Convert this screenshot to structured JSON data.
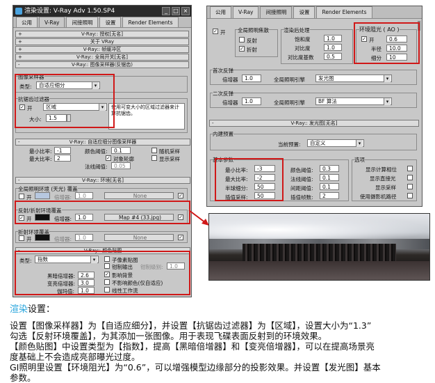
{
  "left": {
    "title": "渲染设置: V-Ray Adv 1.50.SP4",
    "tabs": [
      "公用",
      "V-Ray",
      "间接照明",
      "设置",
      "Render Elements"
    ],
    "rollups": [
      "V-Ray:: 授权[无名]",
      "关于 VRay",
      "V-Ray:: 帧缓冲区",
      "V-Ray:: 全局开关[无名]",
      "V-Ray:: 图像采样器(反锯齿)"
    ],
    "img_sampler_group": "图像采样器",
    "type_label": "类型:",
    "type_value": "自适应细分",
    "aa_group": "抗锯齿过滤器",
    "on_label": "开",
    "filter_value": "区域",
    "size_label": "大小:",
    "size_value": "1.5",
    "filter_desc": "使用可变大小的区域过滤器来计算抗锯齿。",
    "adaptive_rollup": "V-Ray:: 自适应细分图像采样器",
    "min_rate_label": "最小比率:",
    "min_rate": "-1",
    "max_rate_label": "最大比率:",
    "max_rate": "2",
    "clr_thresh_label": "颜色阈值:",
    "clr_thresh": "0.1",
    "obj_outline": "对象轮廓",
    "normal_thresh_label": "法线阈值:",
    "normal_thresh": "0.05",
    "rand_sample": "随机采样",
    "show_samples": "显示采样",
    "env_rollup": "V-Ray:: 环境[无名]",
    "gi_env_label": "全局照明环境 (天光) 覆盖",
    "on": "开",
    "multiplier_label": "倍增器:",
    "gi_mult": "1.0",
    "none1": "None",
    "refl_label": "反射/折射环境覆盖",
    "refl_mult": "1.0",
    "refl_map": "Map #4 (33.jpg)",
    "refr_label": "折射环境覆盖",
    "refr_mult": "1.0",
    "none2": "None",
    "color_rollup": "V-Ray:: 颜色贴图",
    "cm_type_label": "类型:",
    "cm_type": "指数",
    "sub_pixel": "子像素贴图",
    "clamp_out": "钳制输出",
    "clamp_level_label": "钳制级别:",
    "clamp_level": "1.0",
    "dark_mult_label": "黑暗倍增器:",
    "dark_mult": "2.6",
    "bright_mult_label": "变亮倍增器:",
    "bright_mult": "3.0",
    "gamma_label": "伽玛值:",
    "gamma": "1.0",
    "affect_bg": "影响背景",
    "no_affect": "不影响颜色(仅自适应)",
    "linear": "线性工作流"
  },
  "right": {
    "tabs": [
      "公用",
      "V-Ray",
      "间接照明",
      "设置",
      "Render Elements"
    ],
    "on": "开",
    "gi_caustics": "全局照明焦散",
    "reflect": "反射",
    "refract": "折射",
    "post": "渲染后处理",
    "sat_label": "饱和度",
    "sat": "1.0",
    "contrast_label": "对比度",
    "contrast": "1.0",
    "cbase_label": "对比度基数",
    "cbase": "0.5",
    "ao": "环境阻光 ( AO )",
    "ao_on": "开",
    "ao_val": "0.6",
    "radius_label": "半径",
    "radius": "10.0",
    "subdiv_label": "细分",
    "subdiv": "10",
    "primary": "首次反弹",
    "prim_mult_label": "倍增器",
    "prim_mult": "1.0",
    "prim_engine_label": "全局照明引擎",
    "prim_engine": "发光图",
    "secondary": "二次反弹",
    "sec_mult": "1.0",
    "sec_engine": "BF 算法",
    "irr_rollup": "V-Ray:: 发光图[无名]",
    "builtin": "内建预置",
    "preset_label": "当前预置:",
    "preset": "自定义",
    "basic": "基本参数",
    "options": "选项",
    "min_rate_label": "最小比率:",
    "min_rate": "-3",
    "max_rate_label": "最大比率:",
    "max_rate": "-2",
    "hsph_label": "半球细分:",
    "hsph": "50",
    "interp_label": "插值采样:",
    "interp": "50",
    "clr_label": "颜色阈值:",
    "clr": "0.3",
    "nrm_label": "法线阈值:",
    "nrm": "0.1",
    "dist_label": "间距阈值:",
    "dist": "0.1",
    "iframes_label": "插值帧数:",
    "iframes": "2",
    "show_calc": "显示计算相位",
    "show_direct": "显示直接光",
    "show_samples": "显示采样",
    "use_cam": "使用摄影机路径"
  },
  "caption": {
    "heading_a": "渲染",
    "heading_b": "设置：",
    "lines": [
      "设置【图像采样器】为【自适应细分】，并设置【抗锯齿过滤器】为【区域】，设置大小为“1.3”",
      "勾选【反射环境覆盖】，为其添加一张图像。用于表现飞碟表面反射到的环境效果。",
      "【颜色贴图】中设置类型为【指数】，提高【黑暗倍增器】和【变亮倍增器】，可以在提高场景亮",
      "度基础上不会造成亮部曝光过度。",
      "GI照明里设置【环境阻光】为“0.6”，可以增强模型边缘部分的投影效果。并设置【发光图】基本",
      "参数。"
    ]
  },
  "colors": {
    "highlight": "#d01818",
    "accent": "#2aa6dd"
  }
}
